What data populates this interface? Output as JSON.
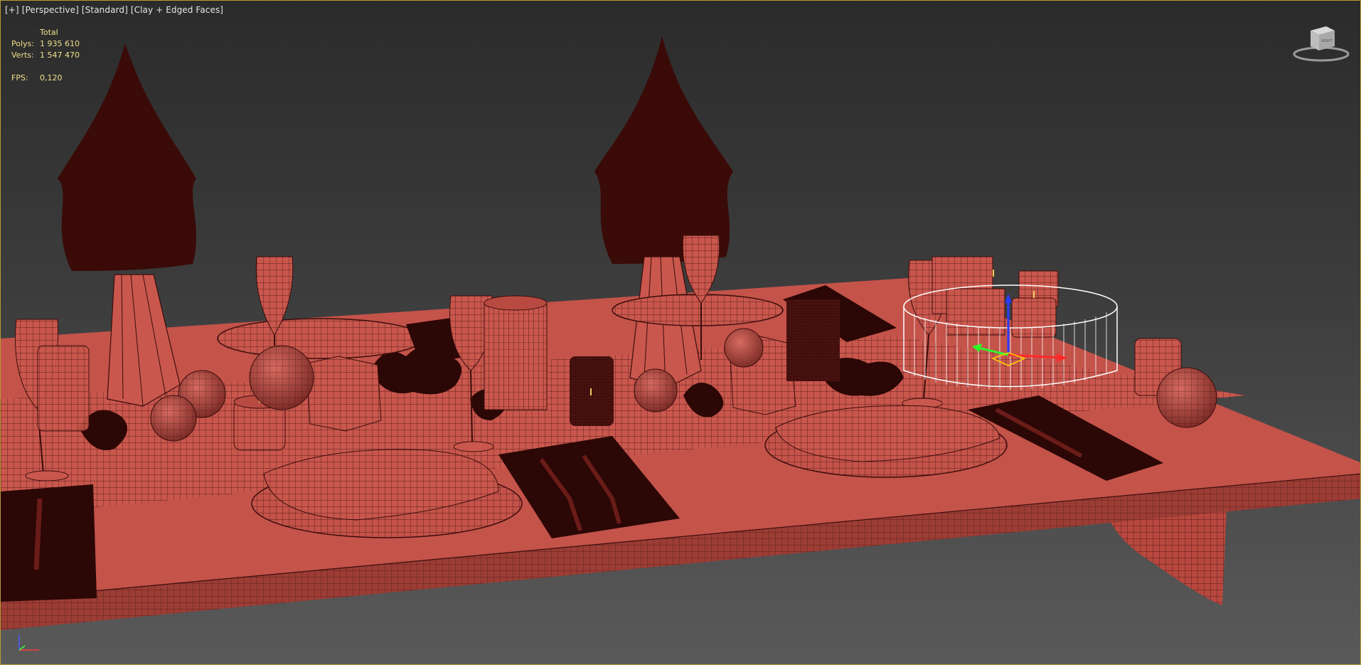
{
  "viewport": {
    "labels": [
      "[+]",
      "[Perspective]",
      "[Standard]",
      "[Clay + Edged Faces]"
    ]
  },
  "stats": {
    "header": "Total",
    "polys_label": "Polys:",
    "polys_value": "1 935 610",
    "verts_label": "Verts:",
    "verts_value": "1 547 470",
    "fps_label": "FPS:",
    "fps_value": "0,120"
  },
  "viewcube": {
    "face_label": "RIGHT"
  },
  "colors": {
    "clay": "#c9544a",
    "clay_dark": "#7a2a25",
    "wire": "#3a0d0b",
    "selection": "#ffffff",
    "stats_text": "#f0e08a",
    "frame_border": "#b79b34"
  },
  "icons": [
    "viewcube-icon",
    "axis-tripod-icon",
    "transform-gizmo-icon"
  ]
}
